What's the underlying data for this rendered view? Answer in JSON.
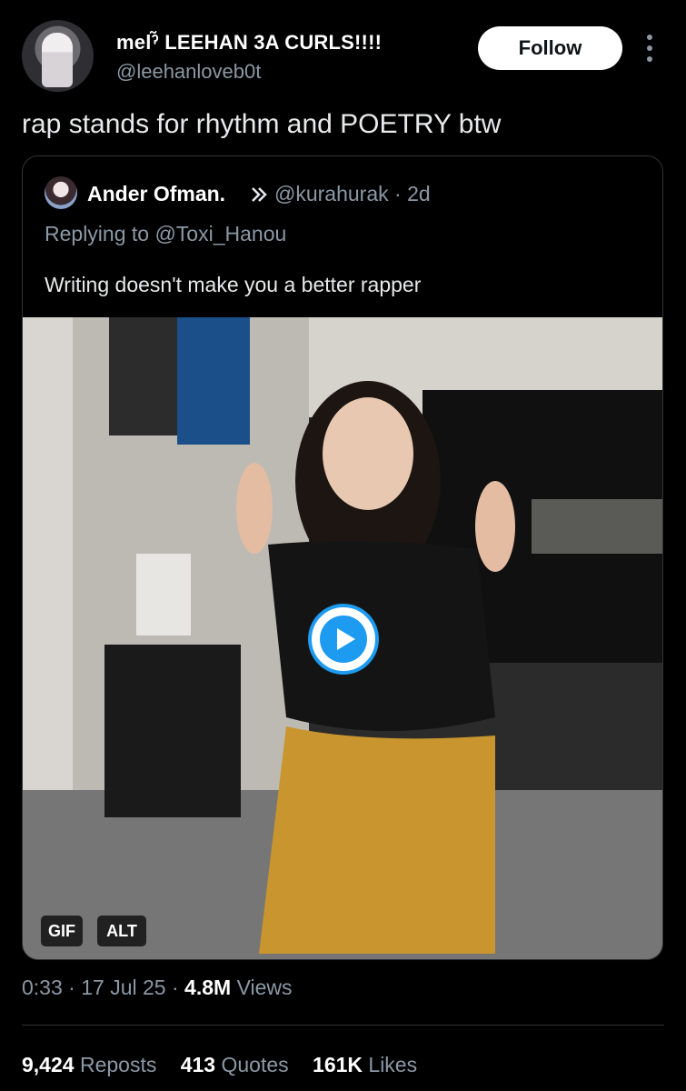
{
  "author": {
    "display_name": "melˀ̃ LEEHAN 3A CURLS!!!!",
    "handle": "@leehanloveb0t"
  },
  "follow_label": "Follow",
  "tweet_text": "rap stands for rhythm and POETRY btw",
  "quoted": {
    "name": "Ander Ofman.",
    "handle": "@kurahurak",
    "time": "2d",
    "replying_to": "Replying to @Toxi_Hanou",
    "text": "Writing doesn't make you a better rapper",
    "media_badges": [
      "GIF",
      "ALT"
    ]
  },
  "meta": {
    "time": "0:33",
    "date": "17 Jul 25",
    "views_count": "4.8M",
    "views_label": "Views"
  },
  "stats": {
    "reposts_count": "9,424",
    "reposts_label": "Reposts",
    "quotes_count": "413",
    "quotes_label": "Quotes",
    "likes_count": "161K",
    "likes_label": "Likes"
  },
  "colors": {
    "background": "#000000",
    "text_primary": "#e7e9ea",
    "text_secondary": "#8b98a5",
    "border": "#2f3336",
    "accent": "#1d9bf0"
  },
  "icons": [
    "more-vertical-icon",
    "verified-badge-icon",
    "play-icon"
  ]
}
